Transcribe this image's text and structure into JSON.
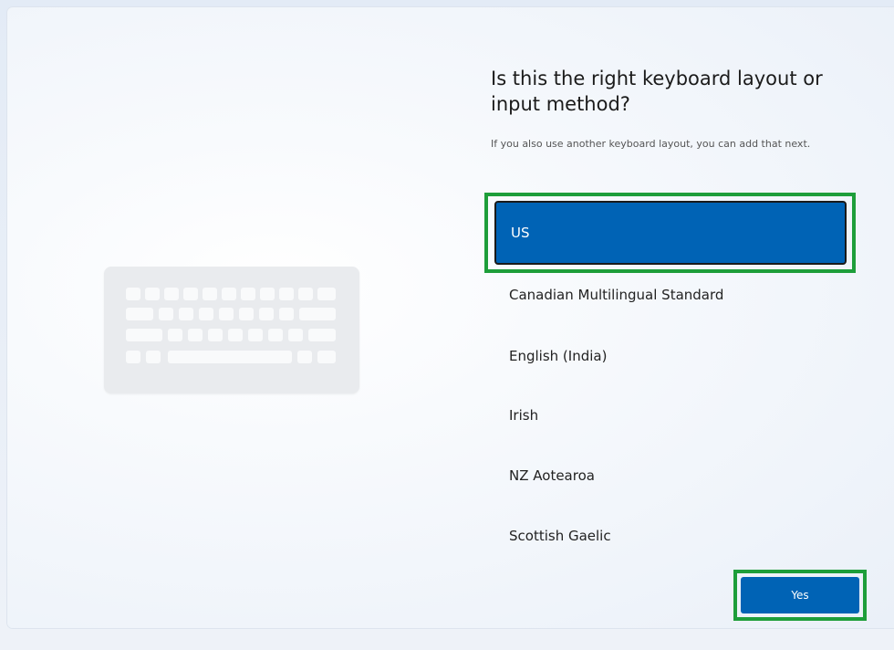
{
  "heading": {
    "title": "Is this the right keyboard layout or input method?",
    "subtitle": "If you also use another keyboard layout, you can add that next."
  },
  "layouts": [
    {
      "label": "US",
      "selected": true
    },
    {
      "label": "Canadian Multilingual Standard",
      "selected": false
    },
    {
      "label": "English (India)",
      "selected": false
    },
    {
      "label": "Irish",
      "selected": false
    },
    {
      "label": "NZ Aotearoa",
      "selected": false
    },
    {
      "label": "Scottish Gaelic",
      "selected": false
    }
  ],
  "actions": {
    "yes_label": "Yes"
  },
  "illustration": {
    "icon": "keyboard-icon"
  },
  "colors": {
    "accent": "#0063b5",
    "highlight": "#1e9e3a"
  }
}
